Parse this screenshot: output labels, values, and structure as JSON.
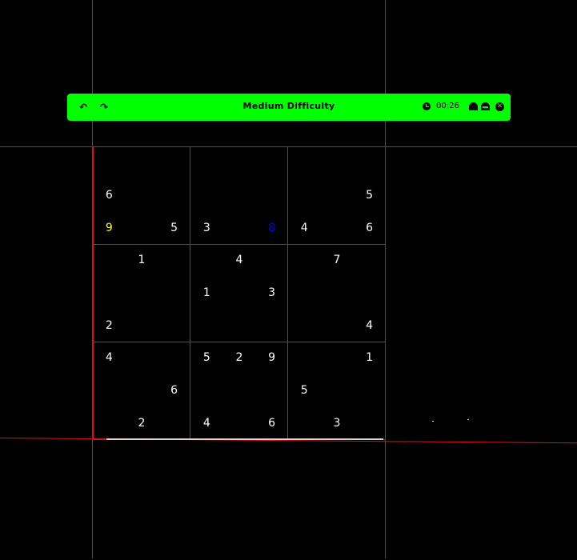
{
  "header": {
    "title": "Medium Difficulty",
    "timer": "00:26",
    "undo_icon": "undo-icon",
    "redo_icon": "redo-icon",
    "close_icon": "close-icon",
    "background_color": "#00ff00"
  },
  "board": {
    "grid_color": "#e01010",
    "digit_color": "#ffffff",
    "hint_color": "#ffff00",
    "user_color": "#0000ff",
    "rows": [
      [
        "",
        "",
        "",
        "",
        "",
        "",
        "",
        "",
        ""
      ],
      [
        "6",
        "",
        "",
        "",
        "",
        "",
        "",
        "",
        "5"
      ],
      [
        "9",
        "",
        "5",
        "3",
        "",
        "8",
        "4",
        "",
        "6"
      ],
      [
        "",
        "1",
        "",
        "",
        "4",
        "",
        "",
        "7",
        ""
      ],
      [
        "",
        "",
        "",
        "1",
        "",
        "3",
        "",
        "",
        ""
      ],
      [
        "2",
        "",
        "",
        "",
        "",
        "",
        "",
        "",
        "4"
      ],
      [
        "4",
        "",
        "",
        "5",
        "2",
        "9",
        "",
        "",
        "1"
      ],
      [
        "",
        "",
        "6",
        "",
        "",
        "",
        "5",
        "",
        ""
      ],
      [
        "",
        "2",
        "",
        "4",
        "",
        "6",
        "",
        "3",
        ""
      ]
    ],
    "special_cells": [
      {
        "row": 2,
        "col": 0,
        "kind": "hint"
      },
      {
        "row": 2,
        "col": 5,
        "kind": "user"
      }
    ]
  }
}
